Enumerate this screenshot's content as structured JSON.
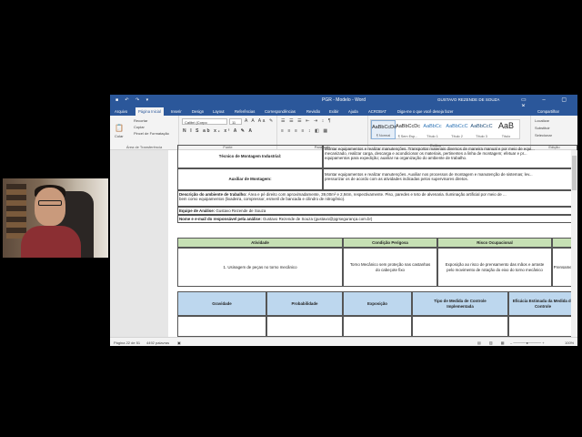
{
  "window": {
    "title": "PGR - Modelo - Word",
    "user": "GUSTAVO REZENDE DE SOUZA",
    "share": "Compartilhar"
  },
  "tabs": [
    "Arquivo",
    "Página Inicial",
    "Inserir",
    "Design",
    "Layout",
    "Referências",
    "Correspondências",
    "Revisão",
    "Exibir",
    "Ajuda",
    "ACROBAT",
    "Diga-me o que você deseja fazer"
  ],
  "ribbon": {
    "clipboard": {
      "paste": "Colar",
      "cut": "Recortar",
      "copy": "Copiar",
      "format_painter": "Pincel de Formatação",
      "label": "Área de Transferência"
    },
    "font": {
      "name": "Calibri (Corpo",
      "size": "11",
      "label": "Fonte"
    },
    "paragraph": {
      "label": "Parágrafo"
    },
    "styles": {
      "label": "Estilos",
      "items": [
        {
          "sample": "AaBbCcDc",
          "name": "¶ Normal"
        },
        {
          "sample": "AaBbCcDc",
          "name": "¶ Sem Esp..."
        },
        {
          "sample": "AaBbCc",
          "name": "Título 1"
        },
        {
          "sample": "AaBbCcC",
          "name": "Título 2"
        },
        {
          "sample": "AaBbCcC",
          "name": "Título 3"
        },
        {
          "sample": "AaB",
          "name": "Título"
        }
      ]
    },
    "editing": {
      "find": "Localizar",
      "replace": "Substituir",
      "select": "Selecionar",
      "label": "Edição"
    }
  },
  "document": {
    "top_rows": [
      {
        "role": "Técnico de Montagem Industrial:",
        "text1": "Montar equipamentos e realizar manutenções. Transportar materiais diversos de maneira manual e por meio de equi...",
        "text2": "mecanizado, realizar carga, descarga e acondicionar os materiais, pertinentes a linha de montagem; efetuar e pr...",
        "text3": "equipamentos para expedição; auxiliar na organização do ambiente de trabalho."
      },
      {
        "role": "Auxiliar de Montagem:",
        "text1": "Montar equipamentos e realizar manutenções. Auxiliar nos processos de montagem e manutenção de sistemas; lev...",
        "text2": "pressurizar os de acordo com as atividades indicadas pelos supervisores diretos."
      }
    ],
    "environment_label": "Descrição do ambiente de trabalho:",
    "environment_text1": " Área e pé direito com aproximadamente, 39,00m² e 2,94m, respectivamente. Piso, paredes e teto de alvenaria. Iluminação artificial por meio de ...",
    "environment_text2": "bem como equipamentos (lixadeira, compressor, esmeril de bancada e cilindro de nitrogênio).",
    "team_label": "Equipe de Análise:",
    "team_value": " Gustavo Rezende de Souza",
    "responsible_label": "Nome e e-mail do responsável pela análise:",
    "responsible_value": " Gustavo Rezende de Souza (gustavo@pgrsegurança.com.br)",
    "activity_table": {
      "headers": [
        "Atividade",
        "Condição Perigosa",
        "Risco Ocupacional",
        ""
      ],
      "row": {
        "activity": "1. Usinagem de peças no torno mecânico",
        "condition": "Torno Mecânico sem proteção nas castanhas do cabeçote fixo",
        "risk": "Exposição ao risco de prensamento das mãos e arraste pelo movimento de rotação do eixo do torno mecânico",
        "extra": "Prensame le"
      }
    },
    "eval_table": {
      "headers": [
        "Gravidade",
        "Probabilidade",
        "Exposição",
        "Tipo de Medida de Controle Implementada",
        "Eficácia Estimada da Medida de Controle"
      ]
    }
  },
  "status": {
    "page": "Página 22 de 51",
    "words": "4492 palavras",
    "zoom": "100%"
  }
}
